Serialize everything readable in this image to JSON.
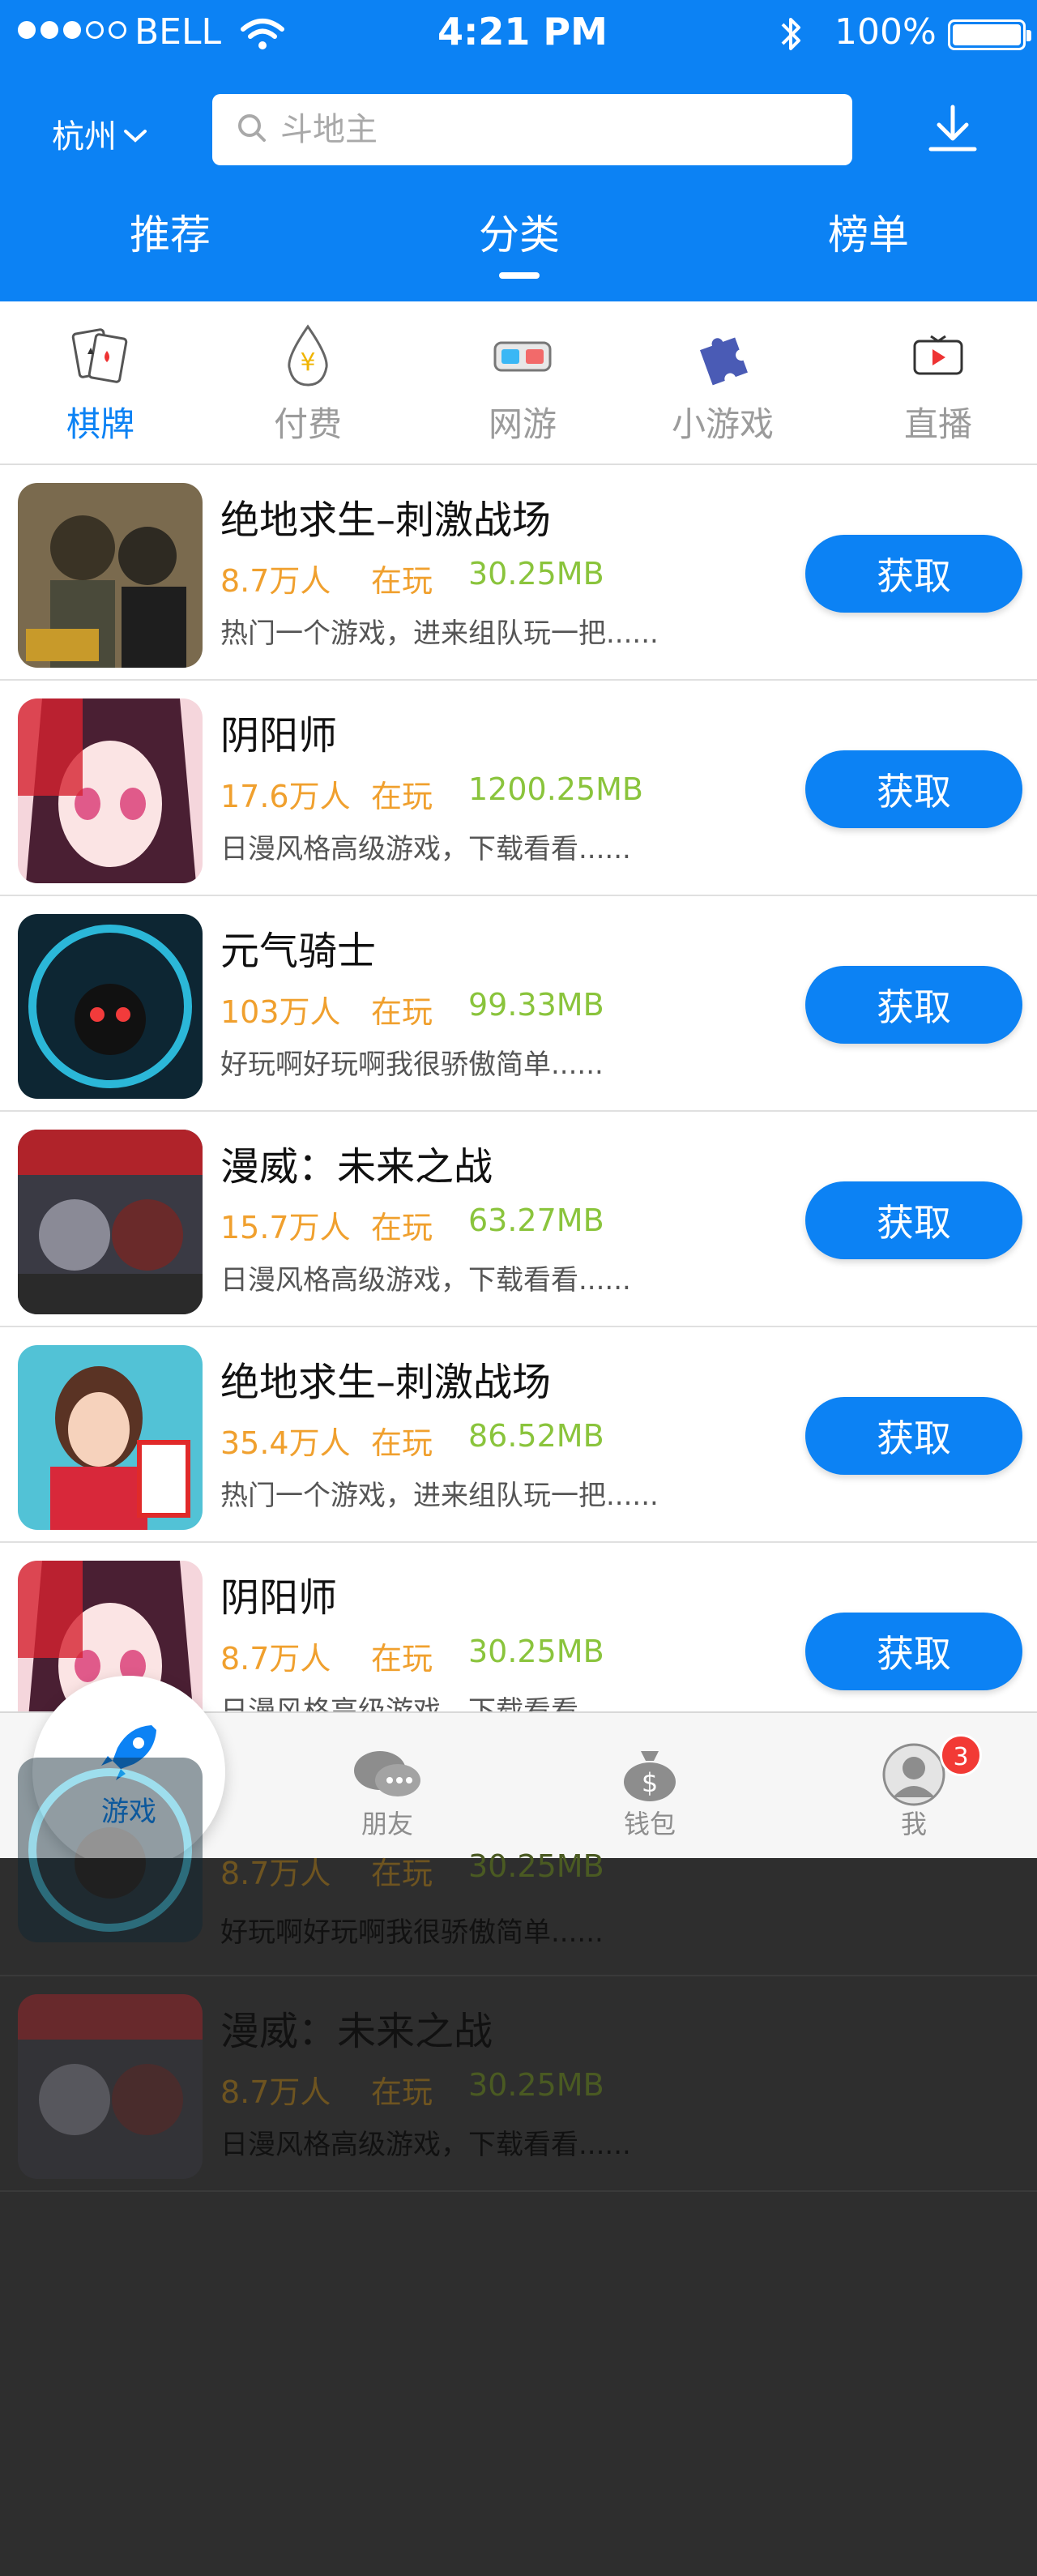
{
  "status_bar": {
    "carrier": "BELL",
    "time": "4:21 PM",
    "battery": "100%"
  },
  "header": {
    "city": "杭州",
    "search_placeholder": "斗地主",
    "tabs": [
      {
        "label": "推荐"
      },
      {
        "label": "分类",
        "active": true
      },
      {
        "label": "榜单"
      }
    ]
  },
  "categories": [
    {
      "label": "棋牌",
      "icon": "playing-cards-icon",
      "active": true
    },
    {
      "label": "付费",
      "icon": "yen-drop-icon"
    },
    {
      "label": "网游",
      "icon": "vr-glasses-icon"
    },
    {
      "label": "小游戏",
      "icon": "puzzle-icon"
    },
    {
      "label": "直播",
      "icon": "live-tv-icon"
    }
  ],
  "games": [
    {
      "name": "绝地求生–刺激战场",
      "players": "8.7万人",
      "state": "在玩",
      "size": "30.25MB",
      "desc": "热门一个游戏，进来组队玩一把......",
      "button": "获取",
      "icon_color": "#7a6a4e"
    },
    {
      "name": "阴阳师",
      "players": "17.6万人",
      "state": "在玩",
      "size": "1200.25MB",
      "desc": "日漫风格高级游戏，下载看看......",
      "button": "获取",
      "icon_color": "#c23b5a"
    },
    {
      "name": "元气骑士",
      "players": "103万人",
      "state": "在玩",
      "size": "99.33MB",
      "desc": "好玩啊好玩啊我很骄傲简单......",
      "button": "获取",
      "icon_color": "#123a4f"
    },
    {
      "name": "漫威：未来之战",
      "players": "15.7万人",
      "state": "在玩",
      "size": "63.27MB",
      "desc": "日漫风格高级游戏，下载看看......",
      "button": "获取",
      "icon_color": "#b0232a"
    },
    {
      "name": "绝地求生–刺激战场",
      "players": "35.4万人",
      "state": "在玩",
      "size": "86.52MB",
      "desc": "热门一个游戏，进来组队玩一把......",
      "button": "获取",
      "icon_color": "#52c2d6"
    },
    {
      "name": "阴阳师",
      "players": "8.7万人",
      "state": "在玩",
      "size": "30.25MB",
      "desc": "日漫风格高级游戏，下载看看......",
      "button": "获取",
      "icon_color": "#c23b5a"
    }
  ],
  "tabbar": {
    "items": [
      {
        "label": "游戏",
        "icon": "rocket-icon",
        "active": true
      },
      {
        "label": "朋友",
        "icon": "chat-bubbles-icon"
      },
      {
        "label": "钱包",
        "icon": "money-bag-icon"
      },
      {
        "label": "我",
        "icon": "user-avatar-icon",
        "badge": "3"
      }
    ]
  },
  "dimmed_rows": [
    {
      "players": "8.7万人",
      "state": "在玩",
      "size": "30.25MB",
      "desc": "好玩啊好玩啊我很骄傲简单......"
    },
    {
      "name": "漫威：未来之战",
      "players": "8.7万人",
      "state": "在玩",
      "size": "30.25MB",
      "desc": "日漫风格高级游戏，下载看看......"
    }
  ],
  "colors": {
    "primary": "#0c82f4",
    "orange": "#f0a02e",
    "green": "#8ac43c",
    "badge": "#f23a35"
  }
}
